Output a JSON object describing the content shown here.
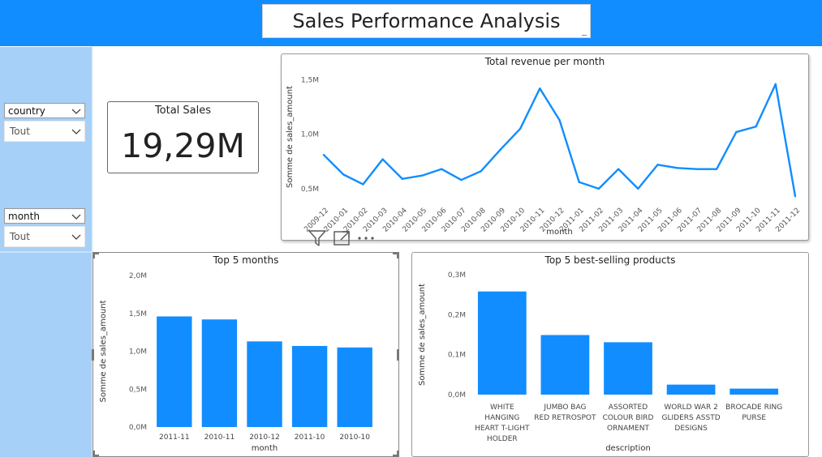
{
  "report": {
    "title": "Sales Performance Analysis"
  },
  "slicers": [
    {
      "field": "country",
      "value": "Tout"
    },
    {
      "field": "month",
      "value": "Tout"
    }
  ],
  "card": {
    "title": "Total Sales",
    "value": "19,29M"
  },
  "colors": {
    "accent": "#118dff",
    "band": "#a6d0f7",
    "bar": "#118dff"
  },
  "icons": [
    "chevron-down-icon",
    "filter-icon",
    "focus-mode-icon",
    "more-options-icon"
  ],
  "chart_data": [
    {
      "id": "revenue",
      "type": "line",
      "title": "Total revenue per month",
      "xlabel": "month",
      "ylabel": "Somme de sales_amount",
      "categories": [
        "2009-12",
        "2010-01",
        "2010-02",
        "2010-03",
        "2010-04",
        "2010-05",
        "2010-06",
        "2010-07",
        "2010-08",
        "2010-09",
        "2010-10",
        "2010-11",
        "2010-12",
        "2011-01",
        "2011-02",
        "2011-03",
        "2011-04",
        "2011-05",
        "2011-06",
        "2011-07",
        "2011-08",
        "2011-09",
        "2011-10",
        "2011-11",
        "2011-12"
      ],
      "series": [
        {
          "values": [
            0.81,
            0.63,
            0.54,
            0.77,
            0.59,
            0.62,
            0.68,
            0.58,
            0.66,
            0.86,
            1.05,
            1.42,
            1.13,
            0.56,
            0.5,
            0.68,
            0.5,
            0.72,
            0.69,
            0.68,
            0.68,
            1.02,
            1.07,
            1.46,
            0.43
          ]
        }
      ],
      "ylim": [
        0.35,
        1.6
      ],
      "yticks": [
        0.5,
        1.0,
        1.5
      ],
      "ytick_labels": [
        "0,5M",
        "1,0M",
        "1,5M"
      ],
      "grid": false,
      "legend": "none"
    },
    {
      "id": "top-months",
      "type": "bar",
      "title": "Top 5 months",
      "xlabel": "month",
      "ylabel": "Somme de sales_amount",
      "categories": [
        "2011-11",
        "2010-11",
        "2010-12",
        "2011-10",
        "2010-10"
      ],
      "values": [
        1.46,
        1.42,
        1.13,
        1.07,
        1.05
      ],
      "ylim": [
        0,
        2.0
      ],
      "yticks": [
        0,
        0.5,
        1.0,
        1.5,
        2.0
      ],
      "ytick_labels": [
        "0,0M",
        "0,5M",
        "1,0M",
        "1,5M",
        "2,0M"
      ],
      "grid": false,
      "legend": "none"
    },
    {
      "id": "top-products",
      "type": "bar",
      "title": "Top 5 best-selling products",
      "xlabel": "description",
      "ylabel": "Somme de sales_amount",
      "categories": [
        "WHITE HANGING HEART T-LIGHT HOLDER",
        "JUMBO BAG RED RETROSPOT",
        "ASSORTED COLOUR BIRD ORNAMENT",
        "WORLD WAR 2 GLIDERS ASSTD DESIGNS",
        "BROCADE RING PURSE"
      ],
      "category_lines": [
        [
          "WHITE",
          "HANGING",
          "HEART T-LIGHT",
          "HOLDER"
        ],
        [
          "JUMBO BAG",
          "RED RETROSPOT"
        ],
        [
          "ASSORTED",
          "COLOUR BIRD",
          "ORNAMENT"
        ],
        [
          "WORLD WAR 2",
          "GLIDERS ASSTD",
          "DESIGNS"
        ],
        [
          "BROCADE RING",
          "PURSE"
        ]
      ],
      "values": [
        0.258,
        0.149,
        0.131,
        0.025,
        0.015
      ],
      "ylim": [
        0,
        0.3
      ],
      "yticks": [
        0,
        0.1,
        0.2,
        0.3
      ],
      "ytick_labels": [
        "0,0M",
        "0,1M",
        "0,2M",
        "0,3M"
      ],
      "grid": false,
      "legend": "none"
    }
  ]
}
